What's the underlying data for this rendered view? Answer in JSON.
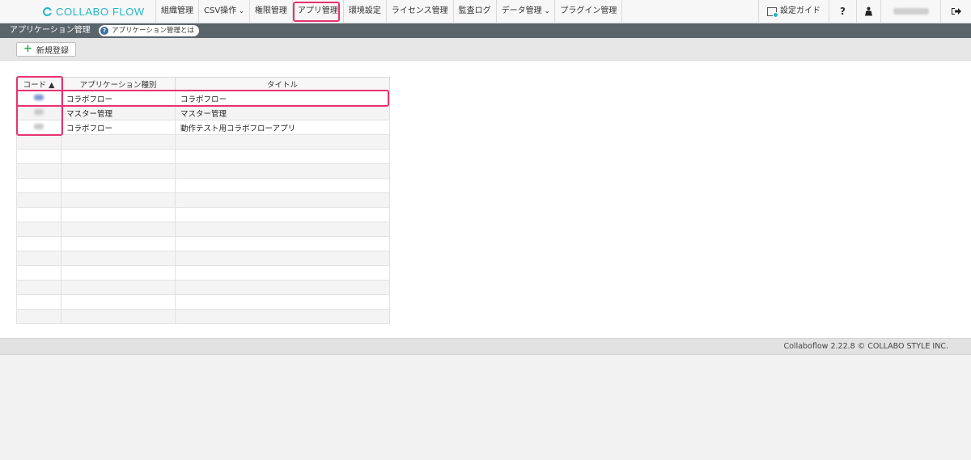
{
  "app": {
    "logo_text": "COLLABO FLOW"
  },
  "nav": {
    "items": [
      {
        "label": "組織管理",
        "dropdown": false
      },
      {
        "label": "CSV操作",
        "dropdown": true
      },
      {
        "label": "権限管理",
        "dropdown": false
      },
      {
        "label": "アプリ管理",
        "dropdown": false,
        "active": true
      },
      {
        "label": "環境設定",
        "dropdown": false
      },
      {
        "label": "ライセンス管理",
        "dropdown": false
      },
      {
        "label": "監査ログ",
        "dropdown": false
      },
      {
        "label": "データ管理",
        "dropdown": true
      },
      {
        "label": "プラグイン管理",
        "dropdown": false
      }
    ],
    "guide_label": "設定ガイド",
    "help_icon": "question-icon",
    "user_icon": "user-icon",
    "logout_icon": "logout-icon"
  },
  "subbar": {
    "page_title": "アプリケーション管理",
    "help_badge": "アプリケーション管理とは"
  },
  "toolbar": {
    "new_button": "新規登録"
  },
  "table": {
    "columns": [
      "コード ▲",
      "アプリケーション種別",
      "タイトル"
    ],
    "rows": [
      {
        "type": "コラボフロー",
        "title": "コラボフロー"
      },
      {
        "type": "マスター管理",
        "title": "マスター管理"
      },
      {
        "type": "コラボフロー",
        "title": "動作テスト用コラボフローアプリ"
      }
    ],
    "empty_rows": 13
  },
  "footer": {
    "copyright": "Collaboflow 2.22.8 © COLLABO STYLE INC."
  },
  "colors": {
    "accent": "#23b5c8",
    "highlight": "#e8336e",
    "subbar": "#5a646b"
  }
}
